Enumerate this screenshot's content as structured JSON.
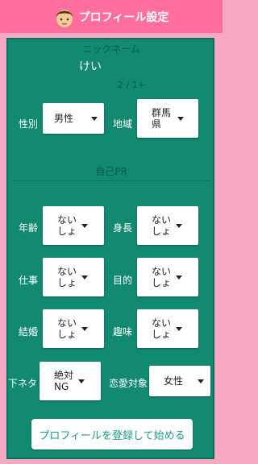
{
  "header": {
    "title": "プロフィール設定",
    "avatar_icon": "boy-face-icon"
  },
  "nickname": {
    "label": "ニックネーム",
    "value": "けい",
    "counter": "2 / 1+"
  },
  "gender": {
    "label": "性別",
    "value": "男性"
  },
  "region": {
    "label": "地域",
    "value": "群馬県"
  },
  "pr_label": "自己PR",
  "age": {
    "label": "年齢",
    "value": "ないしょ"
  },
  "height": {
    "label": "身長",
    "value": "ないしょ"
  },
  "job": {
    "label": "仕事",
    "value": "ないしょ"
  },
  "purpose": {
    "label": "目的",
    "value": "ないしょ"
  },
  "marriage": {
    "label": "結婚",
    "value": "ないしょ"
  },
  "hobby": {
    "label": "趣味",
    "value": "ないしょ"
  },
  "dirty_talk": {
    "label": "下ネタ",
    "value": "絶対NG"
  },
  "romance_target": {
    "label": "恋愛対象",
    "value": "女性"
  },
  "submit_label": "プロフィールを登録して始める",
  "colors": {
    "header": "#ff6e9e",
    "background": "#f7a9c4",
    "panel": "#128a72"
  }
}
